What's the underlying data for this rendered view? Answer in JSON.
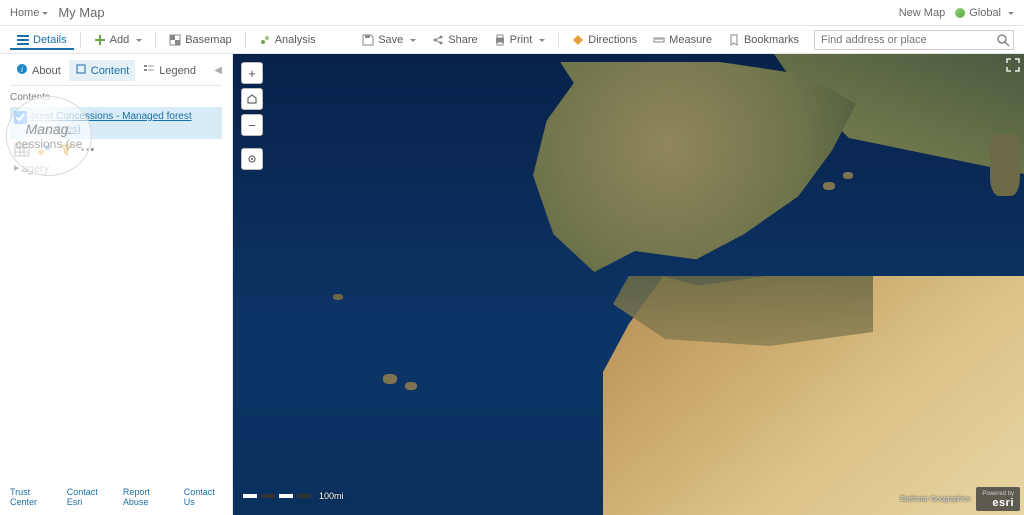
{
  "header": {
    "home": "Home",
    "title": "My Map",
    "new_map": "New Map",
    "global": "Global"
  },
  "toolbar": {
    "details": "Details",
    "add": "Add",
    "basemap": "Basemap",
    "analysis": "Analysis",
    "save": "Save",
    "share": "Share",
    "print": "Print",
    "directions": "Directions",
    "measure": "Measure",
    "bookmarks": "Bookmarks",
    "search_placeholder": "Find address or place"
  },
  "sidebar": {
    "tabs": {
      "about": "About",
      "content": "Content",
      "legend": "Legend"
    },
    "contents_label": "Contents",
    "layer_link": "orest Concessions - Managed forest",
    "layer_link_line2": "t countries)",
    "imagery": "agery",
    "lens": {
      "line1": "Manag.",
      "line2": "cessions (se",
      "line3": " "
    },
    "footer": {
      "trust": "Trust Center",
      "contact_esri": "Contact Esri",
      "report": "Report Abuse",
      "contact_us": "Contact Us"
    }
  },
  "map": {
    "scale_label": "100mi",
    "attribution_source": "Earthstar Geographics",
    "attribution_powered": "Powered by",
    "attribution_logo": "esri"
  }
}
